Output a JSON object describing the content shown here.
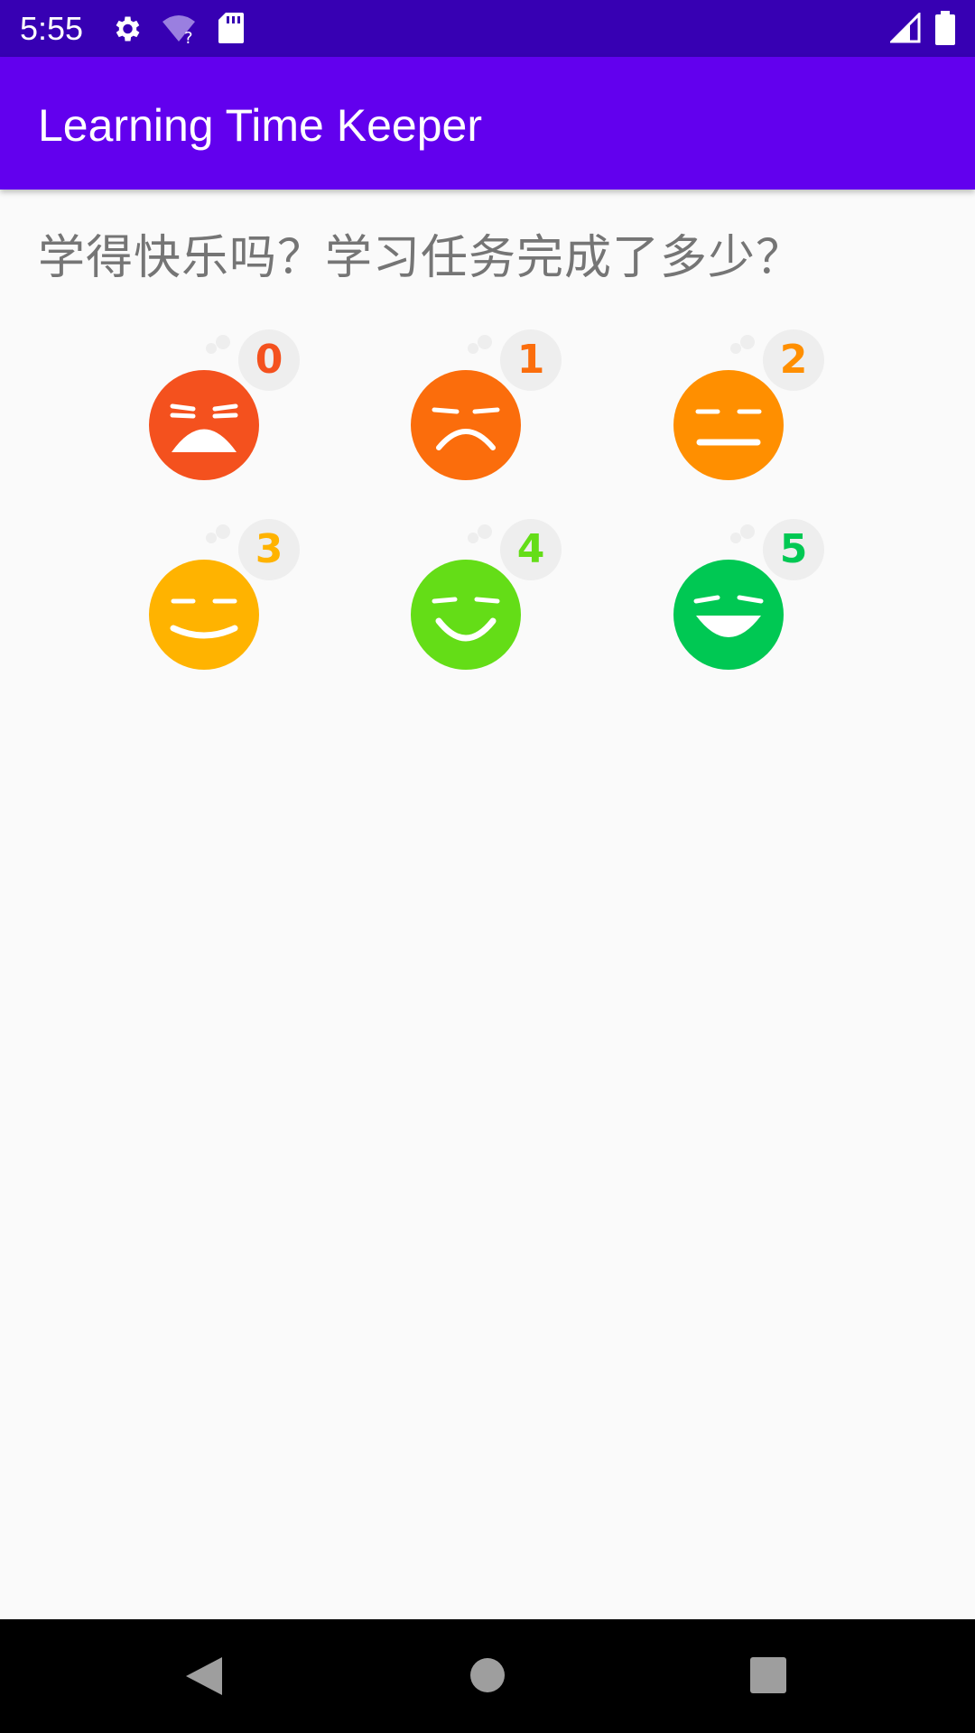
{
  "status_bar": {
    "time": "5:55",
    "icons": [
      "gear-icon",
      "wifi-unknown-icon",
      "sd-card-icon",
      "signal-icon",
      "battery-icon"
    ]
  },
  "app_bar": {
    "title": "Learning Time Keeper",
    "color": "#6200ee"
  },
  "main": {
    "question": "学得快乐吗？学习任务完成了多少？",
    "ratings": [
      {
        "value": "0",
        "mood": "crying",
        "color": "#f4511e"
      },
      {
        "value": "1",
        "mood": "sad",
        "color": "#fb6d0c"
      },
      {
        "value": "2",
        "mood": "neutral",
        "color": "#ff8f00"
      },
      {
        "value": "3",
        "mood": "slight-smile",
        "color": "#ffb300"
      },
      {
        "value": "4",
        "mood": "smile",
        "color": "#64dd17"
      },
      {
        "value": "5",
        "mood": "laugh",
        "color": "#00c853"
      }
    ]
  },
  "nav_bar": {
    "buttons": [
      "back-icon",
      "home-icon",
      "recents-icon"
    ]
  }
}
